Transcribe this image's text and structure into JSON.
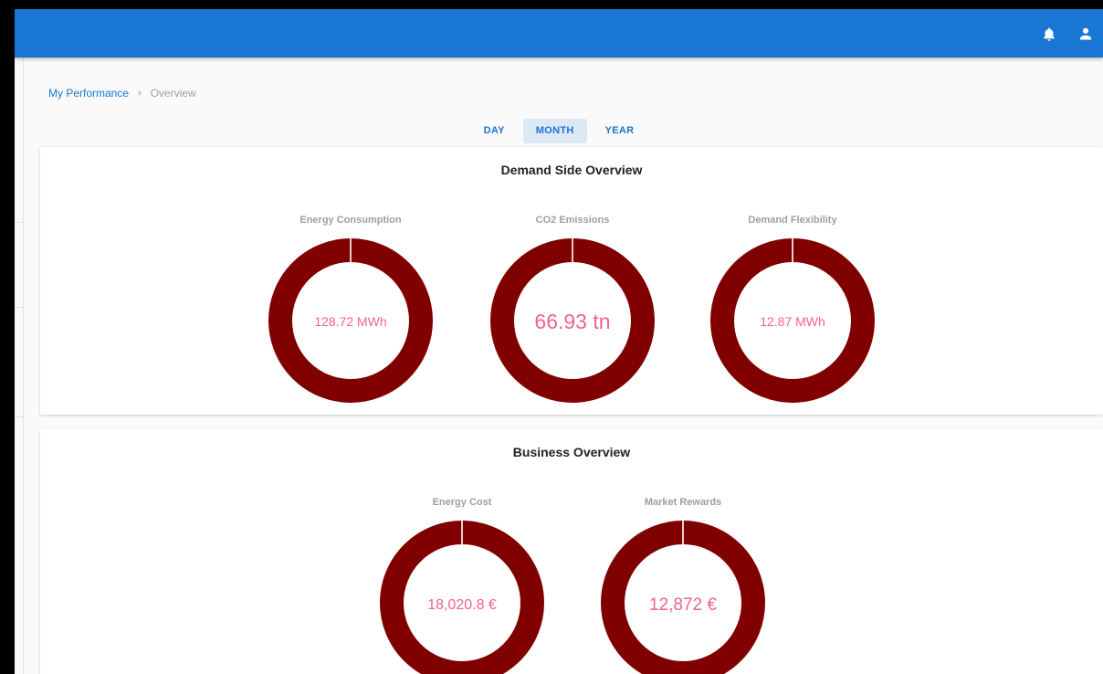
{
  "breadcrumb": {
    "root": "My Performance",
    "separator": "›",
    "current": "Overview"
  },
  "period_tabs": [
    {
      "label": "DAY",
      "active": false
    },
    {
      "label": "MONTH",
      "active": true
    },
    {
      "label": "YEAR",
      "active": false
    }
  ],
  "icons": {
    "notifications": "bell-icon",
    "account": "user-icon"
  },
  "colors": {
    "topbar": "#1976d2",
    "donut_ring": "#800000",
    "donut_value": "#f06292",
    "label_gray": "#9e9e9e"
  },
  "demand": {
    "title": "Demand Side Overview",
    "gauges": [
      {
        "label": "Energy Consumption",
        "value": "128.72 MWh"
      },
      {
        "label": "CO2 Emissions",
        "value": "66.93 tn"
      },
      {
        "label": "Demand Flexibility",
        "value": "12.87 MWh"
      }
    ]
  },
  "business": {
    "title": "Business Overview",
    "gauges": [
      {
        "label": "Energy Cost",
        "value": "18,020.8 €"
      },
      {
        "label": "Market Rewards",
        "value": "12,872 €"
      }
    ]
  }
}
